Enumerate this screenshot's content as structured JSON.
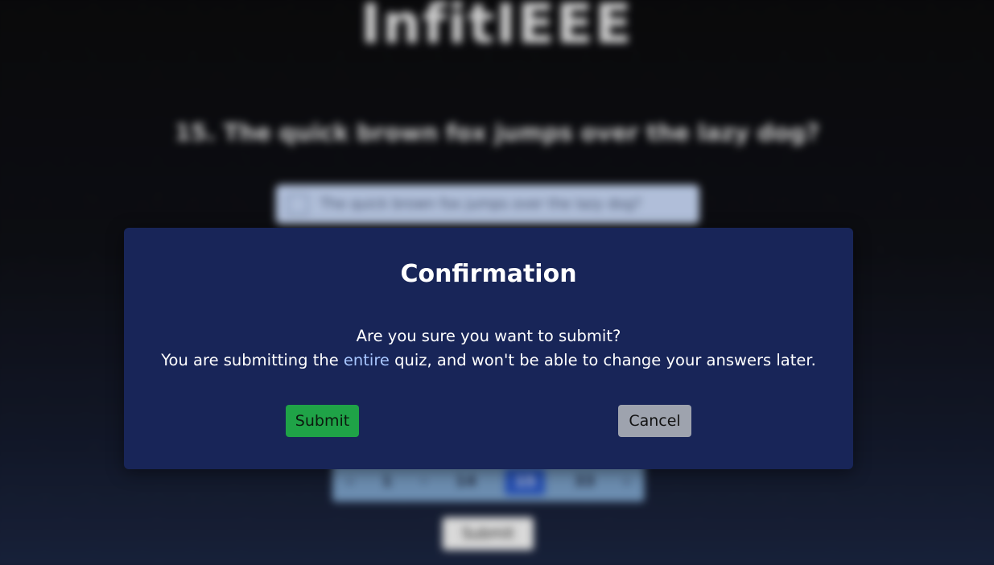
{
  "background": {
    "logo": "InfitIEEE",
    "question": "15. The quick brown fox jumps over the lazy dog?",
    "option": "The quick brown fox jumps over the lazy dog?",
    "pager": [
      "‹",
      "1",
      "·",
      "14",
      "15",
      "33",
      "›"
    ],
    "pager_active": "15",
    "submit_label": "Submit"
  },
  "modal": {
    "title": "Confirmation",
    "line1": "Are you sure you want to submit?",
    "line2_before": "You are submitting the ",
    "line2_highlight": "entire",
    "line2_after": " quiz, and won't be able to change your answers later.",
    "submit_label": "Submit",
    "cancel_label": "Cancel"
  },
  "colors": {
    "modal_bg": "#182558",
    "submit_bg": "#1fa347",
    "cancel_bg": "#9ea3ae",
    "highlight": "#a9c7ff"
  }
}
